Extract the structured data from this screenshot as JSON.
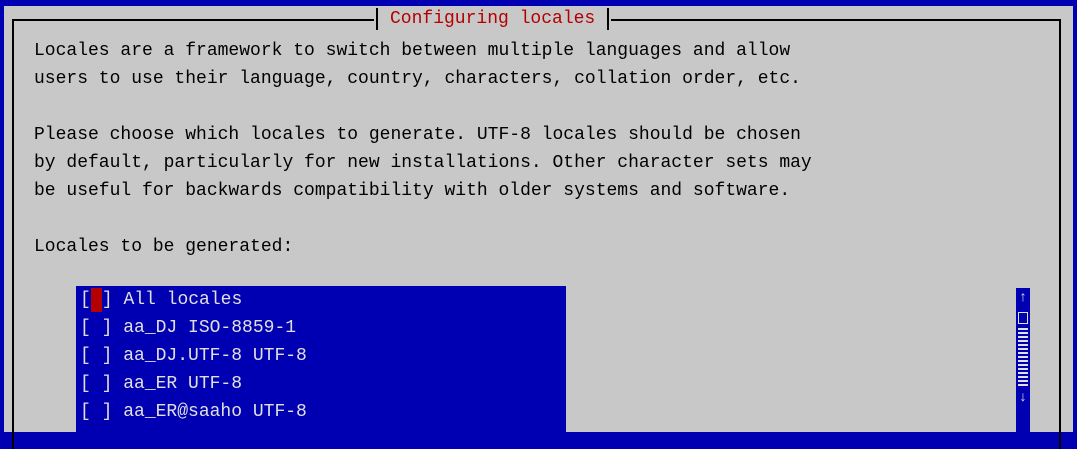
{
  "dialog": {
    "title": "Configuring locales",
    "paragraphs": [
      "Locales are a framework to switch between multiple languages and allow",
      "users to use their language, country, characters, collation order, etc.",
      "",
      "Please choose which locales to generate. UTF-8 locales should be chosen",
      "by default, particularly for new installations. Other character sets may",
      "be useful for backwards compatibility with older systems and software.",
      "",
      "Locales to be generated:"
    ]
  },
  "locales": {
    "items": [
      {
        "label": "All locales",
        "checked": false,
        "focused": true
      },
      {
        "label": "aa_DJ ISO-8859-1",
        "checked": false,
        "focused": false
      },
      {
        "label": "aa_DJ.UTF-8 UTF-8",
        "checked": false,
        "focused": false
      },
      {
        "label": "aa_ER UTF-8",
        "checked": false,
        "focused": false
      },
      {
        "label": "aa_ER@saaho UTF-8",
        "checked": false,
        "focused": false
      }
    ]
  },
  "scrollbar": {
    "up_glyph": "↑",
    "down_glyph": "↓"
  },
  "colors": {
    "background": "#0000b2",
    "dialog": "#c8c8c8",
    "title": "#b40000",
    "list_text": "#e0e0e0",
    "cursor": "#b40000"
  }
}
